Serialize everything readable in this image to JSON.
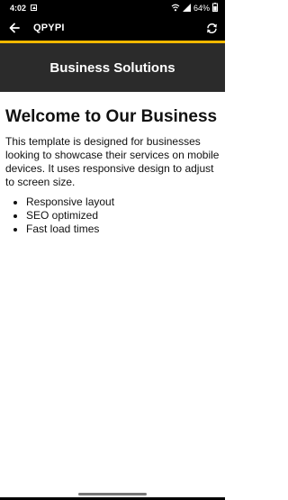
{
  "status_bar": {
    "time": "4:02",
    "battery": "64%",
    "icons": [
      "image-icon",
      "wifi-icon",
      "signal-icon",
      "battery-icon"
    ]
  },
  "app_bar": {
    "title": "QPYPI",
    "back_icon": "arrow-left-icon",
    "refresh_icon": "refresh-icon"
  },
  "page_header": {
    "title": "Business Solutions"
  },
  "content": {
    "heading": "Welcome to Our Business",
    "paragraph": "This template is designed for businesses looking to showcase their services on mobile devices. It uses responsive design to adjust to screen size.",
    "features": [
      "Responsive layout",
      "SEO optimized",
      "Fast load times"
    ]
  },
  "colors": {
    "status_bar": "#000000",
    "app_bar": "#000000",
    "accent": "#f2b800",
    "header_bg": "#2b2b2b",
    "page_bg": "#ffffff",
    "text": "#111111"
  }
}
